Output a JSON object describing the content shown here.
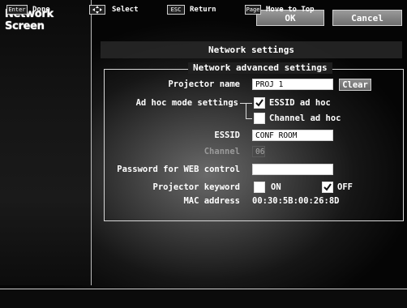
{
  "app": {
    "title": "Network Screen"
  },
  "top_buttons": {
    "ok_label": "OK",
    "cancel_label": "Cancel"
  },
  "section": {
    "title": "Network settings"
  },
  "advanced": {
    "title": "Network advanced settings",
    "projector_name": {
      "label": "Projector name",
      "value": "PROJ 1",
      "clear_label": "Clear"
    },
    "ad_hoc": {
      "label": "Ad hoc mode settings",
      "options": [
        {
          "label": "ESSID ad hoc",
          "checked": true
        },
        {
          "label": "Channel ad hoc",
          "checked": false
        }
      ]
    },
    "essid": {
      "label": "ESSID",
      "value": "CONF ROOM"
    },
    "channel": {
      "label": "Channel",
      "value": "06"
    },
    "password": {
      "label": "Password for WEB control",
      "value": ""
    },
    "keyword": {
      "label": "Projector keyword",
      "on_label": "ON",
      "off_label": "OFF",
      "on_checked": false,
      "off_checked": true
    },
    "mac": {
      "label": "MAC address",
      "value": "00:30:5B:00:26:8D"
    }
  },
  "footer": {
    "items": [
      {
        "key": "Enter",
        "label": "Done"
      },
      {
        "key": "dpad-icon",
        "label": "Select"
      },
      {
        "key": "ESC",
        "label": "Return"
      },
      {
        "key": "Page",
        "label": "Move to Top"
      }
    ]
  }
}
